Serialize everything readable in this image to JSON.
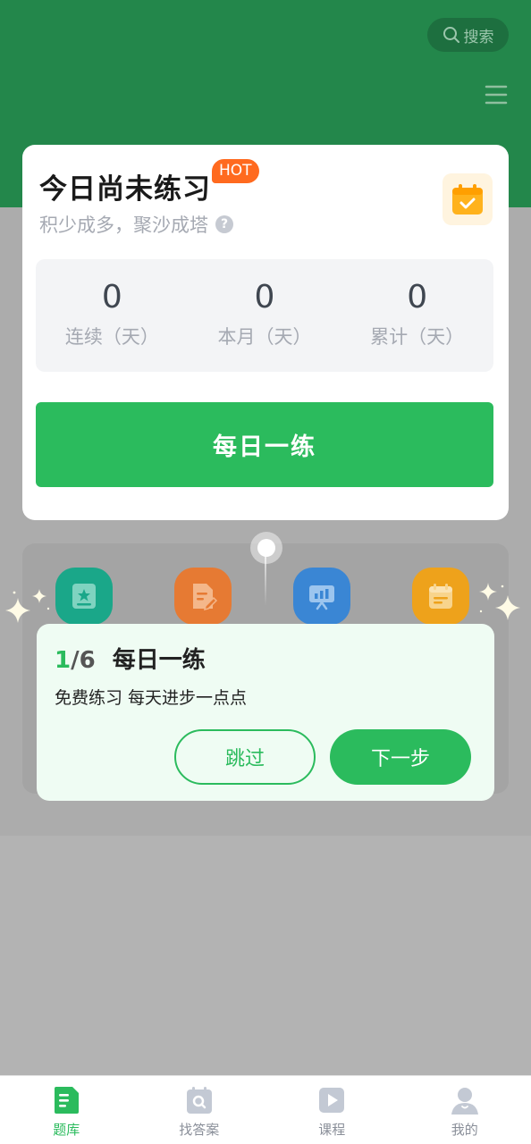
{
  "header": {
    "search_label": "搜索"
  },
  "practice_card": {
    "title": "今日尚未练习",
    "hot_badge": "HOT",
    "subtitle": "积少成多，聚沙成塔",
    "help_mark": "?",
    "stats": [
      {
        "value": "0",
        "label": "连续（天）"
      },
      {
        "value": "0",
        "label": "本月（天）"
      },
      {
        "value": "0",
        "label": "累计（天）"
      }
    ],
    "daily_button": "每日一练"
  },
  "quick_icons": [
    {
      "icon": "star-card-icon",
      "color": "#1aa789"
    },
    {
      "icon": "edit-doc-icon",
      "color": "#e67a33"
    },
    {
      "icon": "presentation-chart-icon",
      "color": "#3a86d4"
    },
    {
      "icon": "calendar-icon",
      "color": "#eea21b"
    }
  ],
  "guide": {
    "step_current": "1",
    "step_total": "/6",
    "title": "每日一练",
    "description": "免费练习 每天进步一点点",
    "skip_label": "跳过",
    "next_label": "下一步"
  },
  "tabbar": {
    "items": [
      {
        "label": "题库",
        "icon": "question-bank-icon",
        "active": true
      },
      {
        "label": "找答案",
        "icon": "find-answer-icon",
        "active": false
      },
      {
        "label": "课程",
        "icon": "course-play-icon",
        "active": false
      },
      {
        "label": "我的",
        "icon": "profile-icon",
        "active": false
      }
    ]
  },
  "colors": {
    "brand_green": "#2bbb5d",
    "header_green": "#23874b",
    "hot_orange": "#ff6a1f"
  }
}
